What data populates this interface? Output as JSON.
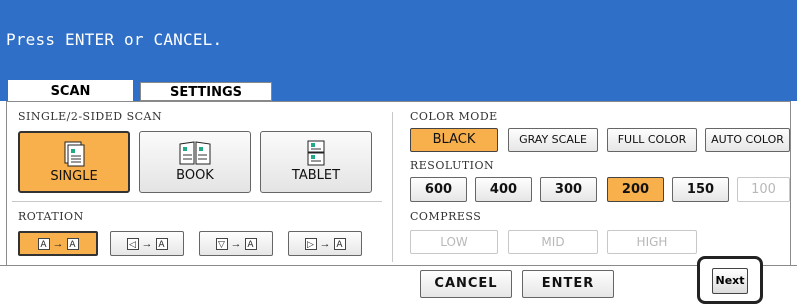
{
  "header": {
    "message": "Press ENTER or CANCEL."
  },
  "tabs": [
    {
      "label": "SCAN"
    },
    {
      "label": "SETTINGS"
    }
  ],
  "scan": {
    "sided_label": "SINGLE/2-SIDED SCAN",
    "modes": [
      {
        "label": "SINGLE"
      },
      {
        "label": "BOOK"
      },
      {
        "label": "TABLET"
      }
    ],
    "rotation_label": "ROTATION",
    "rotation": {
      "glyph": "A",
      "arrow": "→",
      "from_marks": [
        "",
        "◁",
        "▽",
        "▷"
      ]
    }
  },
  "settings": {
    "color_mode_label": "COLOR MODE",
    "color_modes": [
      {
        "label": "BLACK"
      },
      {
        "label": "GRAY SCALE"
      },
      {
        "label": "FULL COLOR"
      },
      {
        "label": "AUTO COLOR"
      }
    ],
    "resolution_label": "RESOLUTION",
    "resolutions": [
      {
        "label": "600"
      },
      {
        "label": "400"
      },
      {
        "label": "300"
      },
      {
        "label": "200"
      },
      {
        "label": "150"
      },
      {
        "label": "100"
      }
    ],
    "compress_label": "COMPRESS",
    "compress": [
      {
        "label": "LOW"
      },
      {
        "label": "MID"
      },
      {
        "label": "HIGH"
      }
    ]
  },
  "footer": {
    "cancel": "CANCEL",
    "enter": "ENTER",
    "next": "Next"
  },
  "colors": {
    "header_bg": "#2f6fc7",
    "selected": "#f7b04c"
  }
}
